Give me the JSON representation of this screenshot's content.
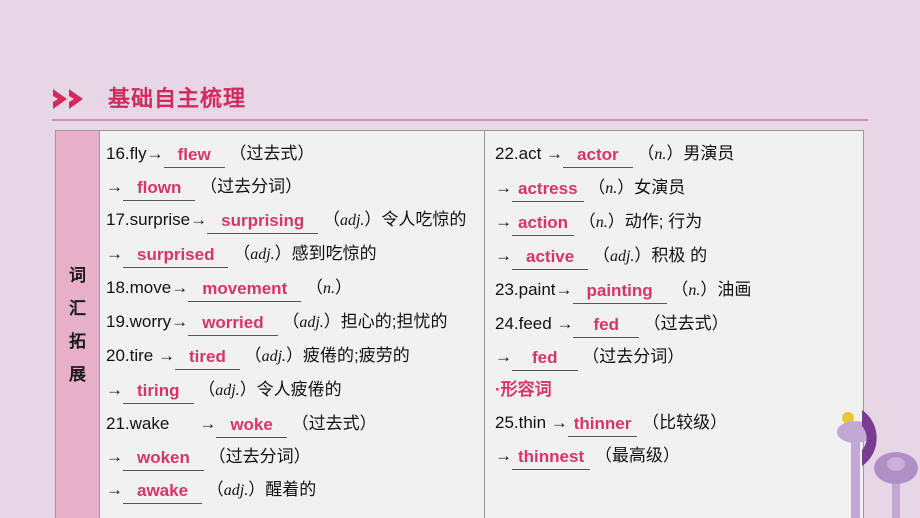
{
  "page": {
    "background_color": "#e7d6e6",
    "accent_color": "#d12b5e",
    "answer_color": "#d6356a",
    "label_strip_color": "#e8afc8"
  },
  "header": {
    "icon": "double-chevron-right-icon",
    "title": "基础自主梳理"
  },
  "table": {
    "row_label_chars": [
      "词",
      "汇",
      "拓",
      "展"
    ],
    "left_column": [
      {
        "id": "16",
        "parts": [
          {
            "t": "text",
            "v": "16.fly→"
          },
          {
            "t": "answer",
            "v": "flew",
            "w": "wide"
          },
          {
            "t": "text",
            "v": " （过去式）"
          }
        ]
      },
      {
        "id": "16b",
        "parts": [
          {
            "t": "text",
            "v": "→"
          },
          {
            "t": "answer",
            "v": "flown",
            "w": "wide"
          },
          {
            "t": "text",
            "v": " （过去分词）"
          }
        ]
      },
      {
        "id": "17",
        "wrap": true,
        "parts": [
          {
            "t": "text",
            "v": "17.surprise→"
          },
          {
            "t": "answer",
            "v": "surprising",
            "w": "wide"
          },
          {
            "t": "text",
            "v": " （"
          },
          {
            "t": "pos",
            "v": "adj."
          },
          {
            "t": "text",
            "v": "）令人吃惊的"
          }
        ]
      },
      {
        "id": "17b",
        "parts": [
          {
            "t": "text",
            "v": "→"
          },
          {
            "t": "answer",
            "v": "surprised",
            "w": "wide"
          },
          {
            "t": "text",
            "v": " （"
          },
          {
            "t": "pos",
            "v": "adj."
          },
          {
            "t": "text",
            "v": "）感到吃惊的"
          }
        ]
      },
      {
        "id": "18",
        "parts": [
          {
            "t": "text",
            "v": "18.move→"
          },
          {
            "t": "answer",
            "v": "movement",
            "w": "wide"
          },
          {
            "t": "text",
            "v": " （"
          },
          {
            "t": "pos",
            "v": "n."
          },
          {
            "t": "text",
            "v": "）"
          }
        ]
      },
      {
        "id": "19",
        "parts": [
          {
            "t": "text",
            "v": "19.worry→"
          },
          {
            "t": "answer",
            "v": "worried",
            "w": "wide"
          },
          {
            "t": "text",
            "v": " （"
          },
          {
            "t": "pos",
            "v": "adj."
          },
          {
            "t": "text",
            "v": "）担心的;担忧的"
          }
        ]
      },
      {
        "id": "20",
        "parts": [
          {
            "t": "text",
            "v": "20.tire  →"
          },
          {
            "t": "answer",
            "v": "tired",
            "w": "wide"
          },
          {
            "t": "text",
            "v": " （"
          },
          {
            "t": "pos",
            "v": "adj."
          },
          {
            "t": "text",
            "v": "）疲倦的;疲劳的"
          }
        ]
      },
      {
        "id": "20b",
        "parts": [
          {
            "t": "text",
            "v": "→"
          },
          {
            "t": "answer",
            "v": "tiring",
            "w": "wide"
          },
          {
            "t": "text",
            "v": " （"
          },
          {
            "t": "pos",
            "v": "adj."
          },
          {
            "t": "text",
            "v": "）令人疲倦的"
          }
        ]
      },
      {
        "id": "21",
        "parts": [
          {
            "t": "text",
            "v": "21.wake"
          },
          {
            "t": "gap",
            "v": ""
          },
          {
            "t": "text",
            "v": "→"
          },
          {
            "t": "answer",
            "v": "woke",
            "w": "wide"
          },
          {
            "t": "text",
            "v": " （过去式）"
          }
        ]
      },
      {
        "id": "21b",
        "parts": [
          {
            "t": "text",
            "v": "→"
          },
          {
            "t": "answer",
            "v": "woken",
            "w": "wide"
          },
          {
            "t": "text",
            "v": " （过去分词）"
          }
        ]
      },
      {
        "id": "21c",
        "parts": [
          {
            "t": "text",
            "v": "→"
          },
          {
            "t": "answer",
            "v": "awake",
            "w": "wide"
          },
          {
            "t": "text",
            "v": " （"
          },
          {
            "t": "pos",
            "v": "adj."
          },
          {
            "t": "text",
            "v": "）醒着的"
          }
        ]
      }
    ],
    "right_column": [
      {
        "id": "22",
        "parts": [
          {
            "t": "text",
            "v": " 22.act →"
          },
          {
            "t": "answer",
            "v": "actor",
            "w": "wide"
          },
          {
            "t": "text",
            "v": " （"
          },
          {
            "t": "pos",
            "v": "n."
          },
          {
            "t": "text",
            "v": "）男演员"
          }
        ]
      },
      {
        "id": "22b",
        "parts": [
          {
            "t": "text",
            "v": "→"
          },
          {
            "t": "answer",
            "v": "actress",
            "w": "normal"
          },
          {
            "t": "text",
            "v": " （"
          },
          {
            "t": "pos",
            "v": "n."
          },
          {
            "t": "text",
            "v": "）女演员"
          }
        ]
      },
      {
        "id": "22c",
        "parts": [
          {
            "t": "text",
            "v": "→"
          },
          {
            "t": "answer",
            "v": "action",
            "w": "normal"
          },
          {
            "t": "text",
            "v": " （"
          },
          {
            "t": "pos",
            "v": "n."
          },
          {
            "t": "text",
            "v": "）动作; 行为"
          }
        ]
      },
      {
        "id": "22d",
        "parts": [
          {
            "t": "text",
            "v": "→"
          },
          {
            "t": "answer",
            "v": "active",
            "w": "wide"
          },
          {
            "t": "text",
            "v": " （"
          },
          {
            "t": "pos",
            "v": "adj."
          },
          {
            "t": "text",
            "v": "）积极 的"
          }
        ]
      },
      {
        "id": "23",
        "parts": [
          {
            "t": "text",
            "v": "23.paint→"
          },
          {
            "t": "answer",
            "v": "painting",
            "w": "wide"
          },
          {
            "t": "text",
            "v": " （"
          },
          {
            "t": "pos",
            "v": "n."
          },
          {
            "t": "text",
            "v": "）油画"
          }
        ]
      },
      {
        "id": "24",
        "parts": [
          {
            "t": "text",
            "v": "24.feed →"
          },
          {
            "t": "answer",
            "v": "fed",
            "w": "xwide"
          },
          {
            "t": "text",
            "v": " （过去式）"
          }
        ]
      },
      {
        "id": "24b",
        "parts": [
          {
            "t": "text",
            "v": "→"
          },
          {
            "t": "answer",
            "v": "fed",
            "w": "xwide"
          },
          {
            "t": "text",
            "v": " （过去分词）"
          }
        ]
      },
      {
        "id": "adj-head",
        "heading": true,
        "parts": [
          {
            "t": "head",
            "v": "·形容词"
          }
        ]
      },
      {
        "id": "25",
        "parts": [
          {
            "t": "text",
            "v": "25.thin →"
          },
          {
            "t": "answer",
            "v": "thinner",
            "w": "normal"
          },
          {
            "t": "text",
            "v": " （比较级）"
          }
        ]
      },
      {
        "id": "25b",
        "parts": [
          {
            "t": "text",
            "v": "→"
          },
          {
            "t": "answer",
            "v": "thinnest",
            "w": "normal"
          },
          {
            "t": "text",
            "v": " （最高级）"
          }
        ]
      }
    ]
  },
  "decoration": {
    "name": "purple-flower-art",
    "colors": [
      "#7a3b93",
      "#c3a7d4",
      "#b08fc7",
      "#e8c832"
    ]
  }
}
